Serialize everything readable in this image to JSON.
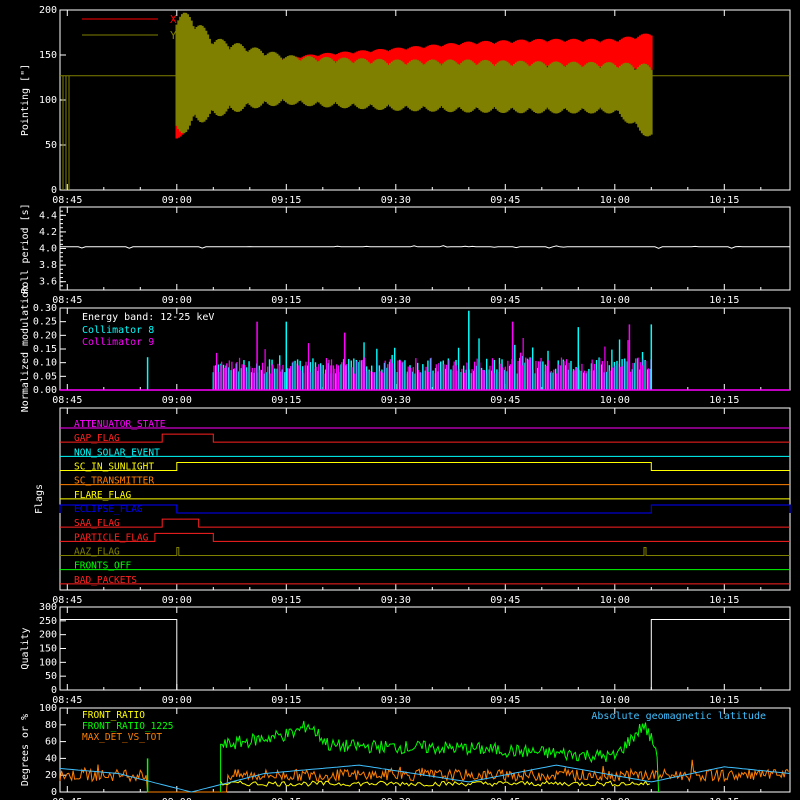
{
  "colors": {
    "axes": "#ffffff",
    "x_series": "#ff0000",
    "y_series": "#808000",
    "cyan": "#00ffff",
    "magenta": "#ff00ff",
    "green": "#00ff00",
    "yellow": "#ffff00",
    "orange": "#ff8000",
    "blue": "#0000ff",
    "red": "#ff2020",
    "lightcyan": "#40c0ff"
  },
  "time_ticks": [
    "08:45",
    "09:00",
    "09:15",
    "09:30",
    "09:45",
    "10:00",
    "10:15"
  ],
  "chart_data": [
    {
      "type": "area",
      "ylabel": "Pointing [\"]",
      "ylim": [
        0,
        200
      ],
      "yticks": [
        "0",
        "50",
        "100",
        "150",
        "200"
      ],
      "xlim": [
        "08:44",
        "10:24"
      ],
      "legend": [
        {
          "name": "X",
          "color": "#ff0000"
        },
        {
          "name": "Y",
          "color": "#808000"
        }
      ],
      "series": [
        {
          "name": "X",
          "x": [
            "09:00",
            "09:02",
            "09:05",
            "09:10",
            "09:15",
            "09:20",
            "09:30",
            "09:40",
            "09:50",
            "10:00",
            "10:05"
          ],
          "low": [
            48,
            80,
            95,
            110,
            120,
            125,
            130,
            132,
            134,
            132,
            130
          ],
          "high": [
            130,
            150,
            160,
            150,
            148,
            152,
            158,
            165,
            168,
            168,
            175
          ]
        },
        {
          "name": "Y",
          "x": [
            "09:00",
            "09:02",
            "09:05",
            "09:10",
            "09:15",
            "09:20",
            "09:30",
            "09:40",
            "09:50",
            "10:00",
            "10:05"
          ],
          "low": [
            55,
            70,
            80,
            90,
            95,
            92,
            88,
            86,
            85,
            85,
            55
          ],
          "high": [
            200,
            195,
            170,
            160,
            150,
            148,
            145,
            145,
            143,
            142,
            140
          ]
        }
      ],
      "baseline": 127
    },
    {
      "type": "line",
      "ylabel": "Roll period [s]",
      "ylim": [
        3.5,
        4.5
      ],
      "yticks": [
        "3.6",
        "3.8",
        "4.0",
        "4.2",
        "4.4"
      ],
      "series": [
        {
          "name": "Roll period",
          "value": 4.02
        }
      ]
    },
    {
      "type": "bar",
      "ylabel": "Normalized modulation",
      "ylim": [
        0.0,
        0.3
      ],
      "yticks": [
        "0.00",
        "0.05",
        "0.10",
        "0.15",
        "0.20",
        "0.25",
        "0.30"
      ],
      "energy_band": "Energy band: 12-25 keV",
      "series": [
        {
          "name": "Collimator 8",
          "color": "#00ffff"
        },
        {
          "name": "Collimator 9",
          "color": "#ff00ff"
        }
      ],
      "active_range": [
        "09:05",
        "10:05"
      ],
      "typical_value": 0.09,
      "peaks": [
        {
          "x": "08:56",
          "value": 0.12
        },
        {
          "x": "09:11",
          "value": 0.25
        },
        {
          "x": "09:15",
          "value": 0.25
        },
        {
          "x": "09:23",
          "value": 0.21
        },
        {
          "x": "09:40",
          "value": 0.29
        },
        {
          "x": "09:46",
          "value": 0.25
        },
        {
          "x": "09:55",
          "value": 0.23
        },
        {
          "x": "10:02",
          "value": 0.24
        },
        {
          "x": "10:05",
          "value": 0.24
        }
      ]
    },
    {
      "type": "line",
      "ylabel": "Flags",
      "flags": [
        {
          "label": "ATTENUATOR_STATE",
          "color": "#ff00ff",
          "high": []
        },
        {
          "label": "GAP_FLAG",
          "color": "#ff2020",
          "high": [
            [
              "08:58",
              "09:05"
            ]
          ]
        },
        {
          "label": "NON_SOLAR_EVENT",
          "color": "#00ffff",
          "high": []
        },
        {
          "label": "SC_IN_SUNLIGHT",
          "color": "#ffff00",
          "high": [
            [
              "09:00",
              "10:05"
            ]
          ]
        },
        {
          "label": "SC_TRANSMITTER",
          "color": "#ff8000",
          "high": []
        },
        {
          "label": "FLARE_FLAG",
          "color": "#ffff00",
          "high": []
        },
        {
          "label": "ECLIPSE_FLAG",
          "color": "#0000ff",
          "high": [
            [
              "08:44",
              "09:00"
            ],
            [
              "10:05",
              "10:24"
            ]
          ]
        },
        {
          "label": "SAA_FLAG",
          "color": "#ff2020",
          "high": [
            [
              "08:58",
              "09:03"
            ]
          ]
        },
        {
          "label": "PARTICLE_FLAG",
          "color": "#ff2020",
          "high": [
            [
              "08:57",
              "09:05"
            ]
          ]
        },
        {
          "label": "AAZ_FLAG",
          "color": "#808000",
          "high": [
            [
              "09:00",
              "09:00"
            ],
            [
              "10:04",
              "10:04"
            ]
          ]
        },
        {
          "label": "FRONTS_OFF",
          "color": "#00ff00",
          "high": []
        },
        {
          "label": "BAD_PACKETS",
          "color": "#ff2020",
          "high": []
        }
      ]
    },
    {
      "type": "line",
      "ylabel": "Quality",
      "ylim": [
        0,
        300
      ],
      "yticks": [
        "0",
        "50",
        "100",
        "150",
        "200",
        "250",
        "300"
      ],
      "series": [
        {
          "name": "Quality",
          "x": [
            "08:44",
            "09:00",
            "09:00",
            "10:05",
            "10:05",
            "10:24"
          ],
          "values": [
            255,
            255,
            0,
            0,
            255,
            255
          ]
        }
      ]
    },
    {
      "type": "line",
      "ylabel": "Degrees or %",
      "ylim": [
        0,
        100
      ],
      "yticks": [
        "0",
        "20",
        "40",
        "60",
        "80",
        "100"
      ],
      "series": [
        {
          "name": "FRONT_RATIO",
          "color": "#ffff00"
        },
        {
          "name": "FRONT_RATIO_1225",
          "color": "#00ff00"
        },
        {
          "name": "MAX_DET_VS_TOT",
          "color": "#ff8000"
        },
        {
          "name": "Absolute geomagnetic latitude",
          "color": "#40c0ff"
        }
      ],
      "geomag_latitude": {
        "x": [
          "08:44",
          "08:52",
          "09:02",
          "09:12",
          "09:25",
          "09:40",
          "09:52",
          "10:05",
          "10:15",
          "10:24"
        ],
        "values": [
          28,
          22,
          0,
          22,
          32,
          12,
          32,
          12,
          30,
          22
        ]
      },
      "green_ratio": {
        "x": [
          "09:06",
          "09:16",
          "09:18",
          "09:21",
          "09:40",
          "10:00",
          "10:04",
          "10:06"
        ],
        "values": [
          55,
          70,
          80,
          55,
          52,
          42,
          80,
          45
        ]
      },
      "orange_level": 20
    }
  ]
}
